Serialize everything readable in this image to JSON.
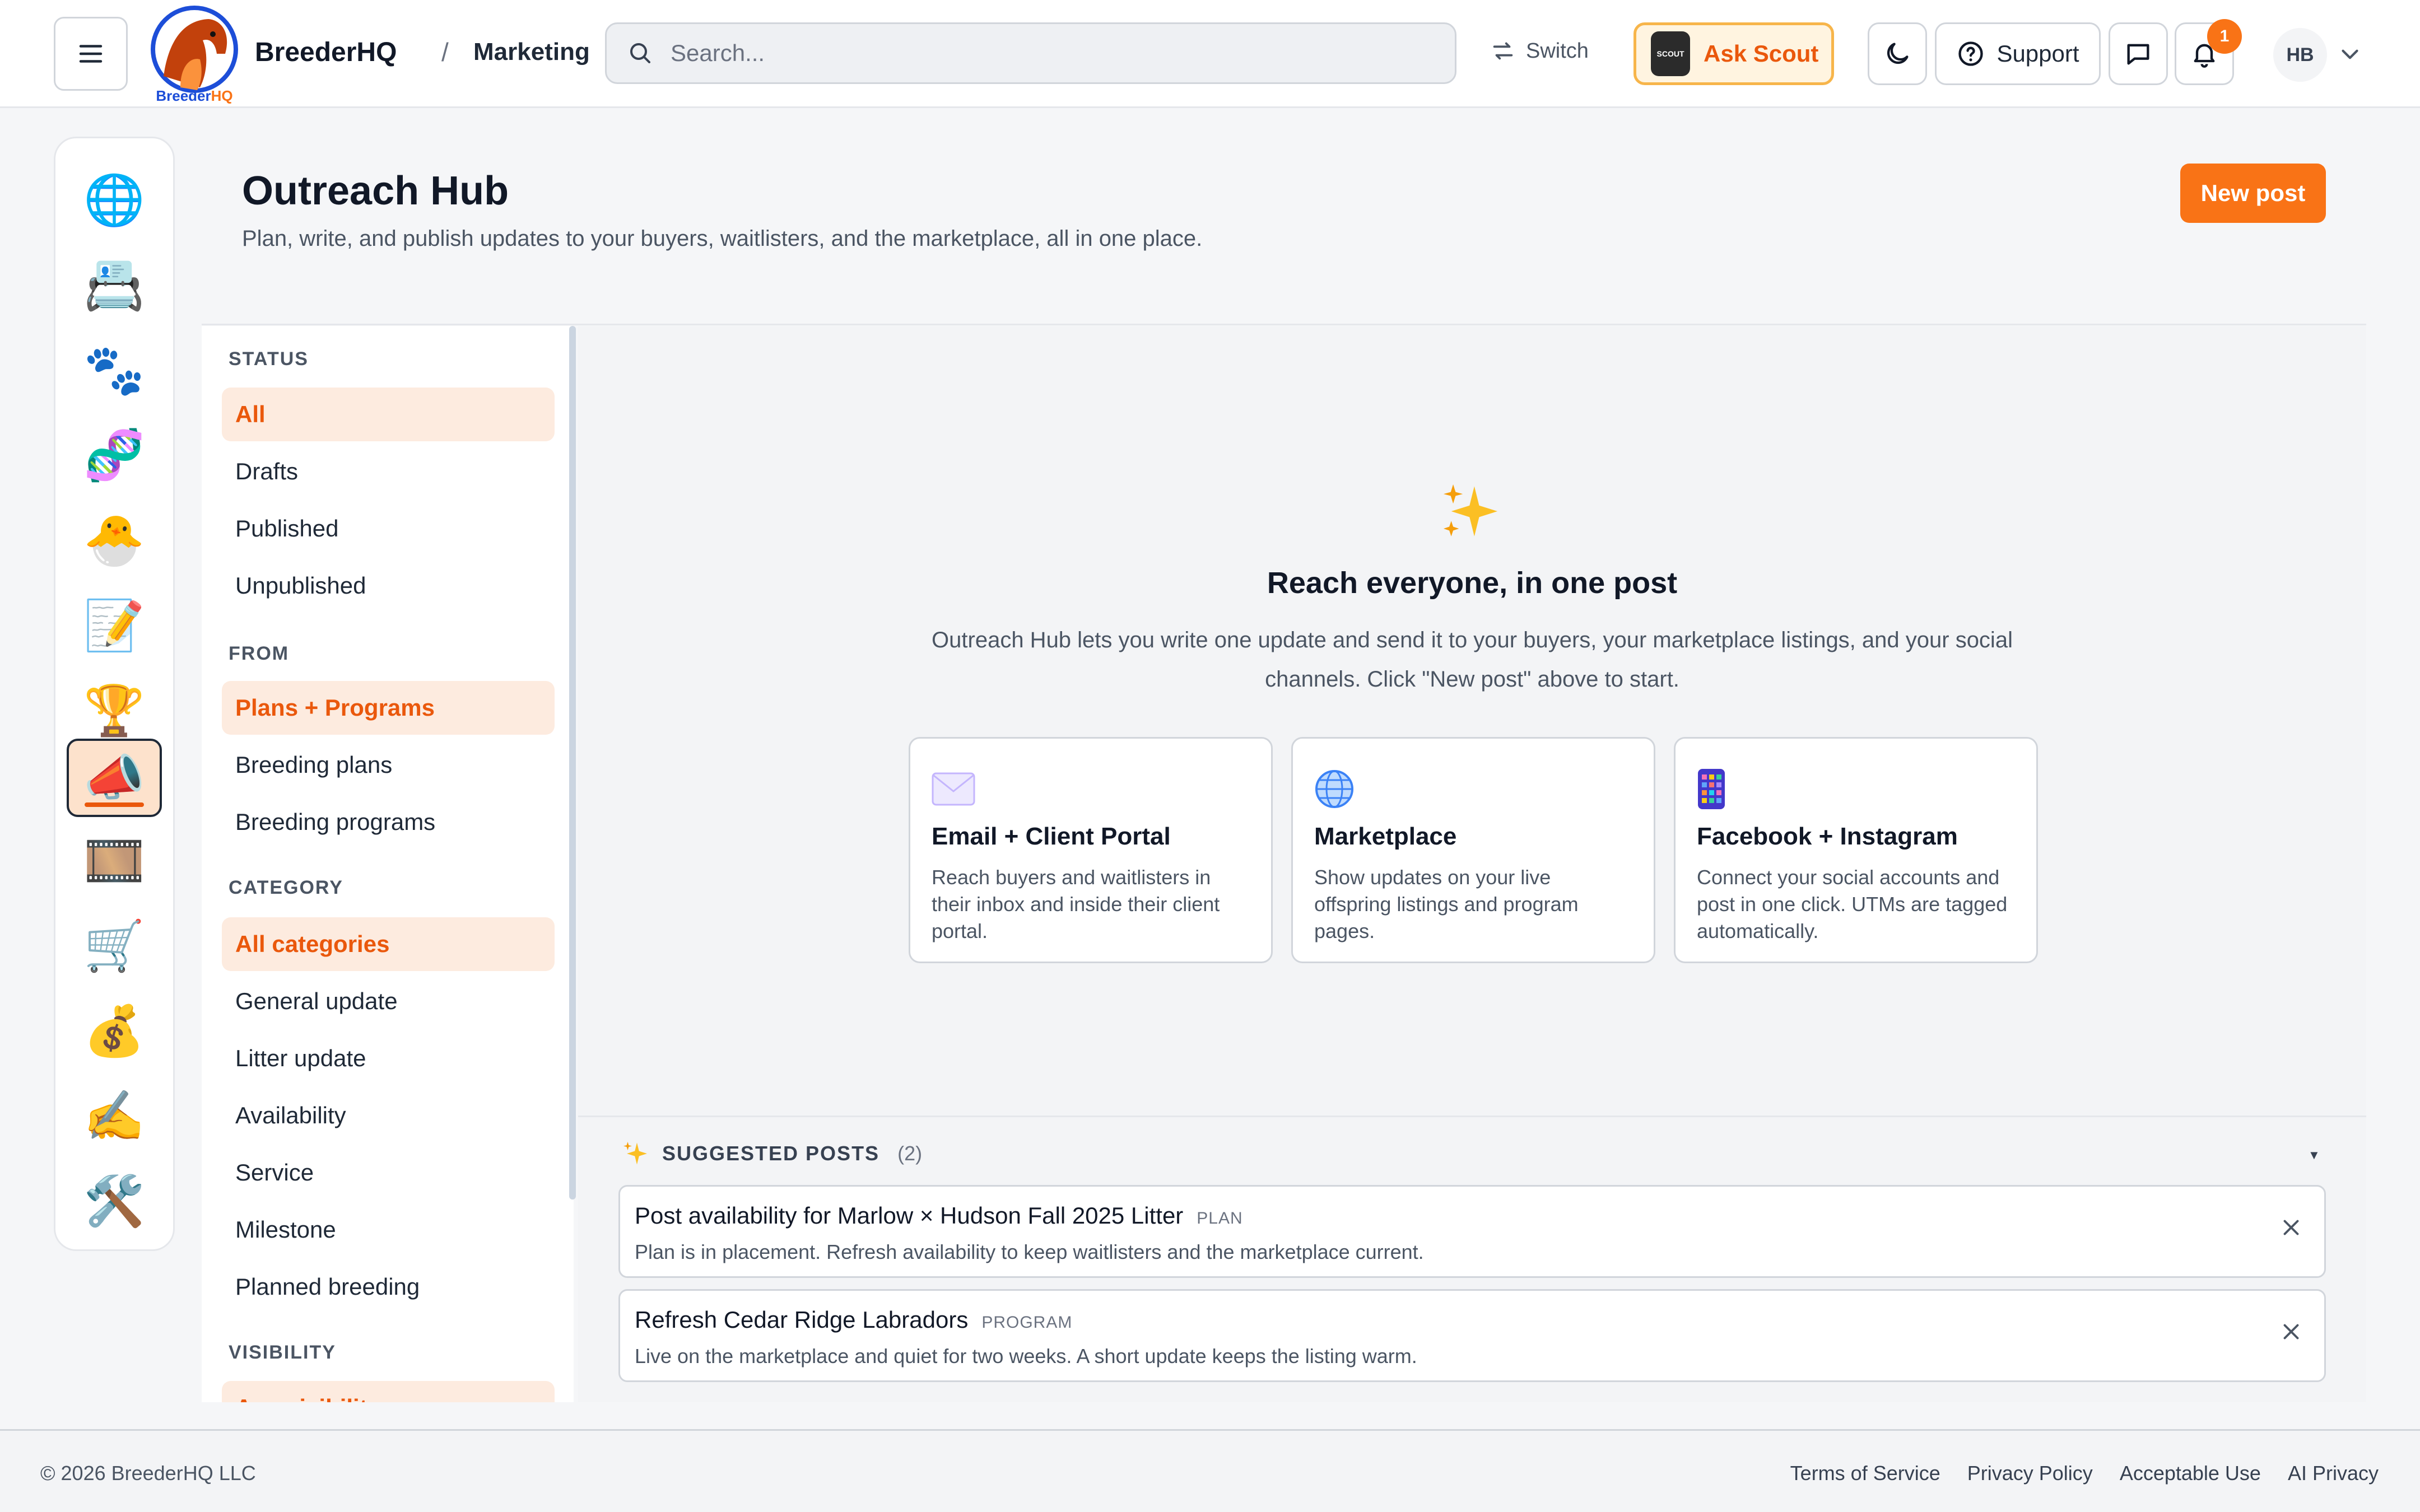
{
  "header": {
    "brand": "BreederHQ",
    "logo_text": "BreederHQ",
    "breadcrumb_sep": "/",
    "breadcrumb": "Marketing",
    "search_placeholder": "Search...",
    "switch_label": "Switch",
    "ask_scout_label": "Ask Scout",
    "scout_badge_text": "SCOUT",
    "support_label": "Support",
    "notification_count": "1",
    "avatar_initials": "HB"
  },
  "rail": {
    "items": [
      {
        "name": "globe-icon",
        "glyph": "🌐"
      },
      {
        "name": "calendar-icon",
        "glyph": "📇"
      },
      {
        "name": "paw-icon",
        "glyph": "🐾"
      },
      {
        "name": "dna-icon",
        "glyph": "🧬"
      },
      {
        "name": "hatching-chick-icon",
        "glyph": "🐣"
      },
      {
        "name": "document-icon",
        "glyph": "📝"
      },
      {
        "name": "trophy-icon",
        "glyph": "🏆"
      },
      {
        "name": "megaphone-icon",
        "glyph": "📣",
        "active": true
      },
      {
        "name": "film-icon",
        "glyph": "🎞️"
      },
      {
        "name": "cart-icon",
        "glyph": "🛒"
      },
      {
        "name": "money-bag-icon",
        "glyph": "💰"
      },
      {
        "name": "signature-icon",
        "glyph": "✍️"
      },
      {
        "name": "tools-icon",
        "glyph": "🛠️"
      }
    ]
  },
  "page": {
    "title": "Outreach Hub",
    "subtitle": "Plan, write, and publish updates to your buyers, waitlisters, and the marketplace, all in one place.",
    "new_post_label": "New post"
  },
  "filters": {
    "status_heading": "STATUS",
    "status_items": [
      "All",
      "Drafts",
      "Published",
      "Unpublished"
    ],
    "from_heading": "FROM",
    "from_items": [
      "Plans + Programs",
      "Breeding plans",
      "Breeding programs"
    ],
    "category_heading": "CATEGORY",
    "category_items": [
      "All categories",
      "General update",
      "Litter update",
      "Availability",
      "Service",
      "Milestone",
      "Planned breeding"
    ],
    "visibility_heading": "VISIBILITY",
    "visibility_items": [
      "Any visibility"
    ]
  },
  "empty_state": {
    "title": "Reach everyone, in one post",
    "description": "Outreach Hub lets you write one update and send it to your buyers, your marketplace listings, and your social channels. Click \"New post\" above to start."
  },
  "channels": [
    {
      "icon": "envelope-icon",
      "title": "Email + Client Portal",
      "description": "Reach buyers and waitlisters in their inbox and inside their client portal."
    },
    {
      "icon": "globe-icon",
      "title": "Marketplace",
      "description": "Show updates on your live offspring listings and program pages."
    },
    {
      "icon": "phone-icon",
      "title": "Facebook + Instagram",
      "description": "Connect your social accounts and post in one click. UTMs are tagged automatically."
    }
  ],
  "suggested": {
    "title": "SUGGESTED POSTS",
    "count": "(2)",
    "posts": [
      {
        "name": "Post availability for Marlow × Hudson Fall 2025 Litter",
        "tag": "PLAN",
        "description": "Plan is in placement. Refresh availability to keep waitlisters and the marketplace current."
      },
      {
        "name": "Refresh Cedar Ridge Labradors",
        "tag": "PROGRAM",
        "description": "Live on the marketplace and quiet for two weeks. A short update keeps the listing warm."
      }
    ]
  },
  "footer": {
    "copyright": "© 2026 BreederHQ LLC",
    "links": [
      "Terms of Service",
      "Privacy Policy",
      "Acceptable Use",
      "AI Privacy"
    ]
  },
  "colors": {
    "accent": "#f97316",
    "accent_dark": "#ea580c",
    "active_bg": "#fdebdf",
    "scout_bg": "#fff4e0"
  }
}
